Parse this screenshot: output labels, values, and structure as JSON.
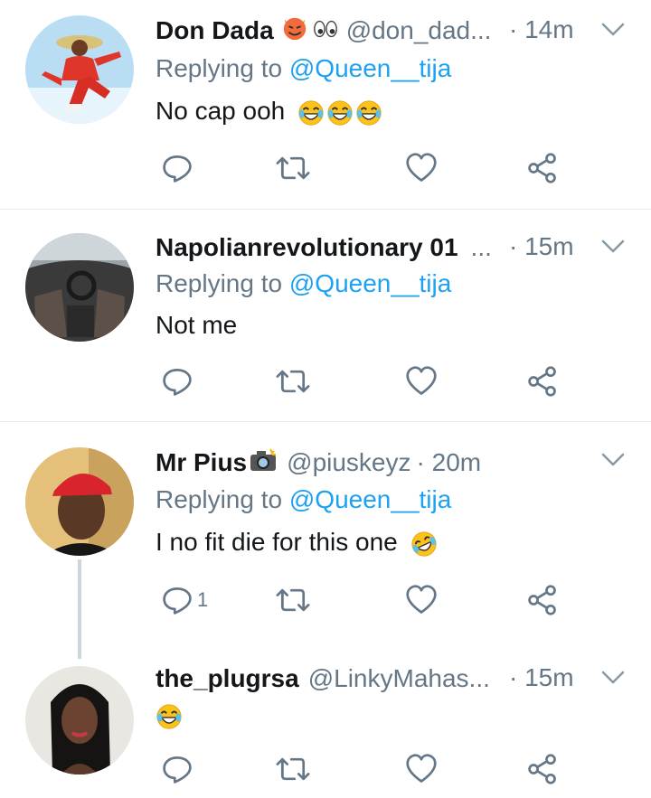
{
  "tweets": [
    {
      "name": "Don Dada",
      "handle": "@don_dad...",
      "time": "· 14m",
      "reply_prefix": "Replying to ",
      "reply_mention": "@Queen__tija",
      "text": "No cap ooh",
      "reply_count": ""
    },
    {
      "name": "Napolianrevolutionary 01",
      "handle": "...",
      "time": "· 15m",
      "reply_prefix": "Replying to ",
      "reply_mention": "@Queen__tija",
      "text": "Not me",
      "reply_count": ""
    },
    {
      "name": "Mr Pius",
      "handle": "@piuskeyz",
      "time": "· 20m",
      "reply_prefix": "Replying to ",
      "reply_mention": "@Queen__tija",
      "text": "I no fit die for this one",
      "reply_count": "1"
    },
    {
      "name": "the_plugrsa",
      "handle": "@LinkyMahas...",
      "time": "· 15m",
      "text": "",
      "reply_count": ""
    }
  ],
  "icons": {
    "reply": "reply-icon",
    "retweet": "retweet-icon",
    "like": "heart-icon",
    "share": "share-icon",
    "menu": "chevron-down-icon"
  },
  "colors": {
    "name": "#14171a",
    "secondary": "#657786",
    "mention": "#1da1f2",
    "divider": "#e6ecf0",
    "thread_line": "#ccd6dd"
  }
}
